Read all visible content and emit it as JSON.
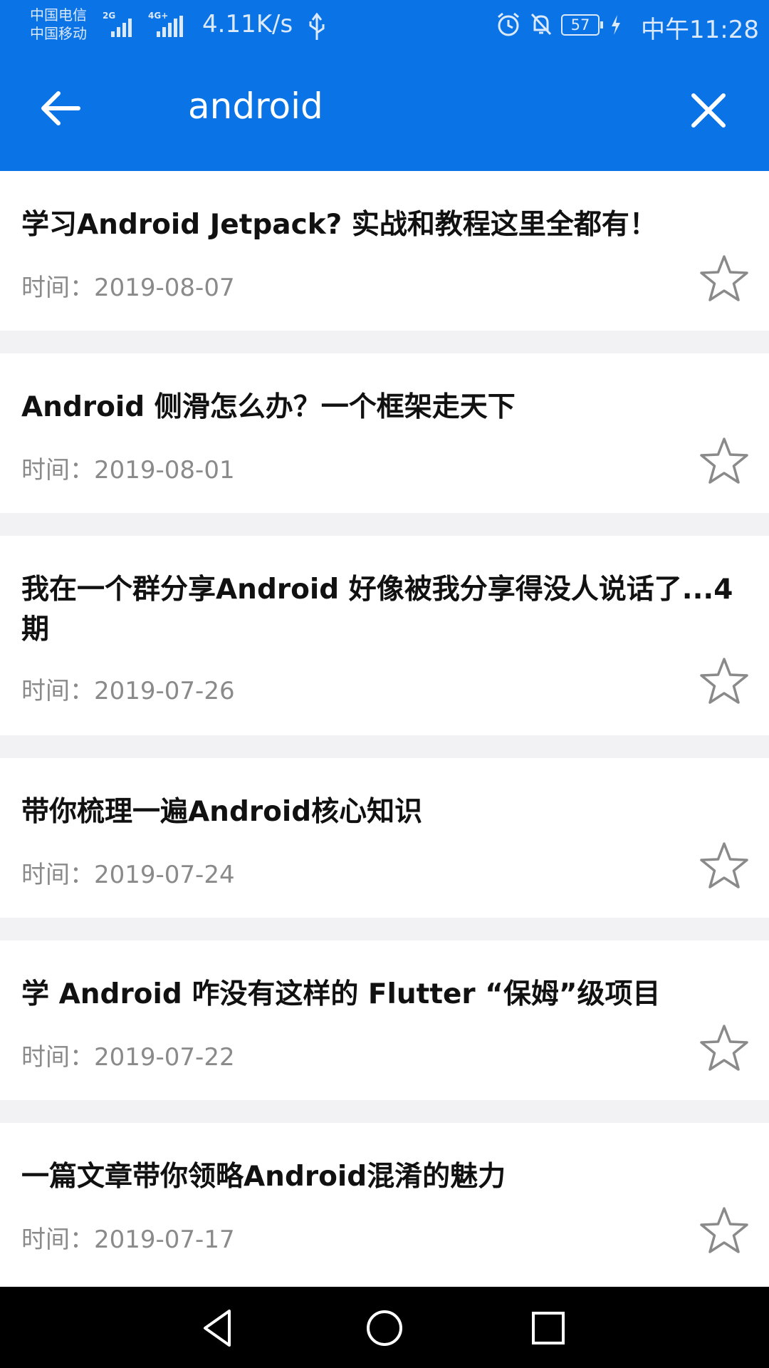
{
  "status_bar": {
    "carrier_1": "中国电信",
    "carrier_2": "中国移动",
    "sim1_network": "2G",
    "sim2_network": "4G+",
    "net_speed": "4.11K/s",
    "battery": "57",
    "time": "中午11:28"
  },
  "search": {
    "query": "android"
  },
  "articles": [
    {
      "title": "学习Android Jetpack? 实战和教程这里全都有！",
      "date": "时间：2019-08-07"
    },
    {
      "title": "Android 侧滑怎么办？一个框架走天下",
      "date": "时间：2019-08-01"
    },
    {
      "title": "我在一个群分享Android 好像被我分享得没人说话了...4期",
      "date": "时间：2019-07-26"
    },
    {
      "title": "带你梳理一遍Android核心知识",
      "date": "时间：2019-07-24"
    },
    {
      "title": "学 Android 咋没有这样的 Flutter “保姆”级项目",
      "date": "时间：2019-07-22"
    },
    {
      "title": "一篇文章带你领略Android混淆的魅力",
      "date": "时间：2019-07-17"
    }
  ],
  "icons": {
    "back": "arrow-left-icon",
    "clear": "close-icon",
    "favorite": "star-outline-icon",
    "nav_back": "triangle-back-icon",
    "nav_home": "circle-home-icon",
    "nav_recents": "square-recents-icon"
  },
  "colors": {
    "accent": "#0a73e6",
    "title_text": "#111111",
    "date_text": "#8a8a8a",
    "background": "#f2f2f5"
  }
}
